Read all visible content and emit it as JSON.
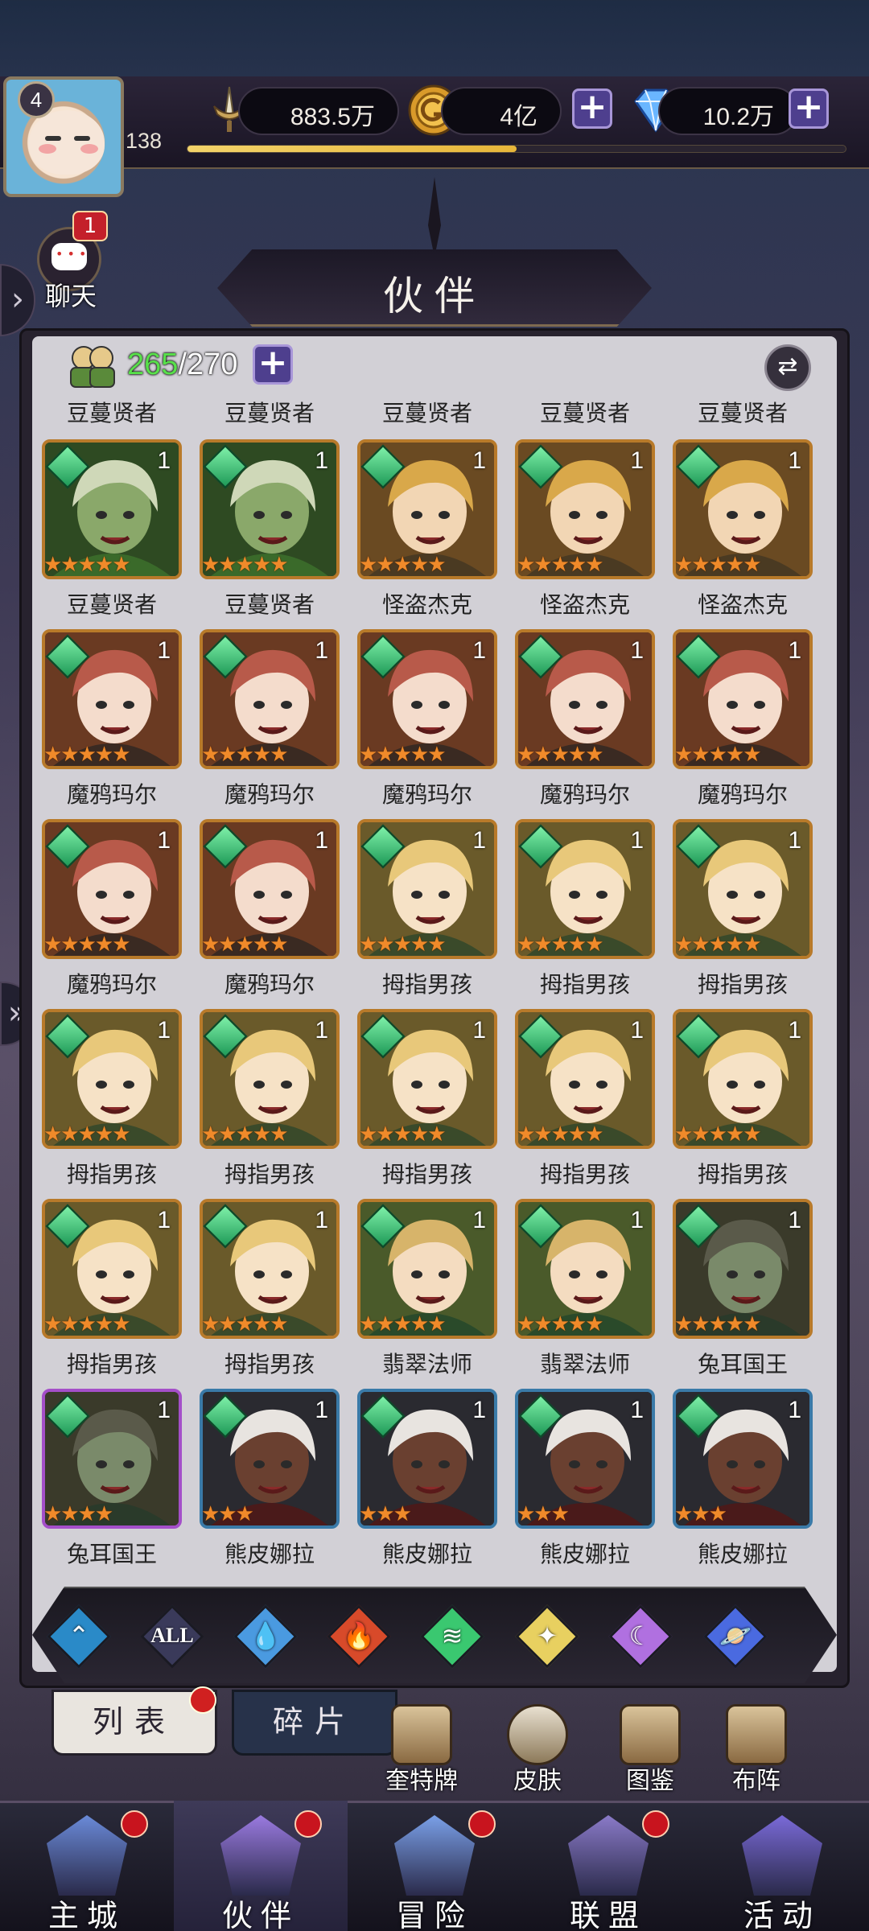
{
  "player": {
    "level": "4",
    "exp_level": "138",
    "exp_progress": 0.5
  },
  "resources": [
    {
      "icon": "sword-icon",
      "value": "883.5万",
      "addable": false
    },
    {
      "icon": "gold-coin-icon",
      "value": "4亿",
      "addable": true
    },
    {
      "icon": "diamond-icon",
      "value": "10.2万",
      "addable": true
    }
  ],
  "chat": {
    "label": "聊天",
    "badge": "1"
  },
  "page_title": "伙伴",
  "roster": {
    "current": "265",
    "max": "/270"
  },
  "top_partial_names": [
    "豆蔓贤者",
    "豆蔓贤者",
    "豆蔓贤者",
    "豆蔓贤者",
    "豆蔓贤者"
  ],
  "partners": [
    {
      "name": "豆蔓贤者",
      "count": "1",
      "stars": "★★★★★",
      "element": "wind",
      "portrait": "green-sage"
    },
    {
      "name": "豆蔓贤者",
      "count": "1",
      "stars": "★★★★★",
      "element": "wind",
      "portrait": "green-sage"
    },
    {
      "name": "怪盗杰克",
      "count": "1",
      "stars": "★★★★★",
      "element": "wind",
      "portrait": "blond-thief"
    },
    {
      "name": "怪盗杰克",
      "count": "1",
      "stars": "★★★★★",
      "element": "wind",
      "portrait": "blond-thief"
    },
    {
      "name": "怪盗杰克",
      "count": "1",
      "stars": "★★★★★",
      "element": "wind",
      "portrait": "blond-thief"
    },
    {
      "name": "魔鸦玛尔",
      "count": "1",
      "stars": "★★★★★",
      "element": "wind",
      "portrait": "red-hair"
    },
    {
      "name": "魔鸦玛尔",
      "count": "1",
      "stars": "★★★★★",
      "element": "wind",
      "portrait": "red-hair"
    },
    {
      "name": "魔鸦玛尔",
      "count": "1",
      "stars": "★★★★★",
      "element": "wind",
      "portrait": "red-hair"
    },
    {
      "name": "魔鸦玛尔",
      "count": "1",
      "stars": "★★★★★",
      "element": "wind",
      "portrait": "red-hair"
    },
    {
      "name": "魔鸦玛尔",
      "count": "1",
      "stars": "★★★★★",
      "element": "wind",
      "portrait": "red-hair"
    },
    {
      "name": "魔鸦玛尔",
      "count": "1",
      "stars": "★★★★★",
      "element": "wind",
      "portrait": "red-hair"
    },
    {
      "name": "魔鸦玛尔",
      "count": "1",
      "stars": "★★★★★",
      "element": "wind",
      "portrait": "red-hair"
    },
    {
      "name": "拇指男孩",
      "count": "1",
      "stars": "★★★★★",
      "element": "wind",
      "portrait": "blond-boy"
    },
    {
      "name": "拇指男孩",
      "count": "1",
      "stars": "★★★★★",
      "element": "wind",
      "portrait": "blond-boy"
    },
    {
      "name": "拇指男孩",
      "count": "1",
      "stars": "★★★★★",
      "element": "wind",
      "portrait": "blond-boy"
    },
    {
      "name": "拇指男孩",
      "count": "1",
      "stars": "★★★★★",
      "element": "wind",
      "portrait": "blond-boy"
    },
    {
      "name": "拇指男孩",
      "count": "1",
      "stars": "★★★★★",
      "element": "wind",
      "portrait": "blond-boy"
    },
    {
      "name": "拇指男孩",
      "count": "1",
      "stars": "★★★★★",
      "element": "wind",
      "portrait": "blond-boy"
    },
    {
      "name": "拇指男孩",
      "count": "1",
      "stars": "★★★★★",
      "element": "wind",
      "portrait": "blond-boy"
    },
    {
      "name": "拇指男孩",
      "count": "1",
      "stars": "★★★★★",
      "element": "wind",
      "portrait": "blond-boy"
    },
    {
      "name": "拇指男孩",
      "count": "1",
      "stars": "★★★★★",
      "element": "wind",
      "portrait": "blond-boy"
    },
    {
      "name": "拇指男孩",
      "count": "1",
      "stars": "★★★★★",
      "element": "wind",
      "portrait": "blond-boy"
    },
    {
      "name": "翡翠法师",
      "count": "1",
      "stars": "★★★★★",
      "element": "wind",
      "portrait": "emerald-mage"
    },
    {
      "name": "翡翠法师",
      "count": "1",
      "stars": "★★★★★",
      "element": "wind",
      "portrait": "emerald-mage"
    },
    {
      "name": "兔耳国王",
      "count": "1",
      "stars": "★★★★★",
      "element": "wind",
      "portrait": "rabbit-king"
    },
    {
      "name": "兔耳国王",
      "count": "1",
      "stars": "★★★★",
      "element": "wind",
      "portrait": "rabbit-king",
      "frame": "purple"
    },
    {
      "name": "熊皮娜拉",
      "count": "1",
      "stars": "★★★",
      "element": "wind",
      "portrait": "bear-girl",
      "frame": "blue"
    },
    {
      "name": "熊皮娜拉",
      "count": "1",
      "stars": "★★★",
      "element": "wind",
      "portrait": "bear-girl",
      "frame": "blue"
    },
    {
      "name": "熊皮娜拉",
      "count": "1",
      "stars": "★★★",
      "element": "wind",
      "portrait": "bear-girl",
      "frame": "blue"
    },
    {
      "name": "熊皮娜拉",
      "count": "1",
      "stars": "★★★",
      "element": "wind",
      "portrait": "bear-girl",
      "frame": "blue"
    }
  ],
  "filters": [
    {
      "id": "light-blue-icon",
      "label": ""
    },
    {
      "id": "all-filter",
      "label": "ALL"
    },
    {
      "id": "water-drop-icon",
      "label": ""
    },
    {
      "id": "fire-icon",
      "label": ""
    },
    {
      "id": "wind-icon",
      "label": ""
    },
    {
      "id": "light-star-icon",
      "label": ""
    },
    {
      "id": "dark-moon-icon",
      "label": ""
    },
    {
      "id": "planet-icon",
      "label": ""
    }
  ],
  "tabs": {
    "list": "列表",
    "fragments": "碎片"
  },
  "shortcuts": [
    {
      "icon": "card-icon",
      "label": "奎特牌"
    },
    {
      "icon": "costume-icon",
      "label": "皮肤"
    },
    {
      "icon": "codex-icon",
      "label": "图鉴"
    },
    {
      "icon": "formation-icon",
      "label": "布阵"
    }
  ],
  "nav": [
    {
      "icon": "castle-icon",
      "label": "主城",
      "dot": true
    },
    {
      "icon": "witch-hat-icon",
      "label": "伙伴",
      "dot": true,
      "active": true
    },
    {
      "icon": "compass-icon",
      "label": "冒险",
      "dot": true
    },
    {
      "icon": "shield-icon",
      "label": "联盟",
      "dot": true
    },
    {
      "icon": "cards-icon",
      "label": "活动",
      "dot": false
    }
  ],
  "colors": {
    "accent_green": "#58e04a",
    "gold_frame": "#b87a2a",
    "badge_red": "#c8141e",
    "plus_purple": "#4e3f8e"
  }
}
